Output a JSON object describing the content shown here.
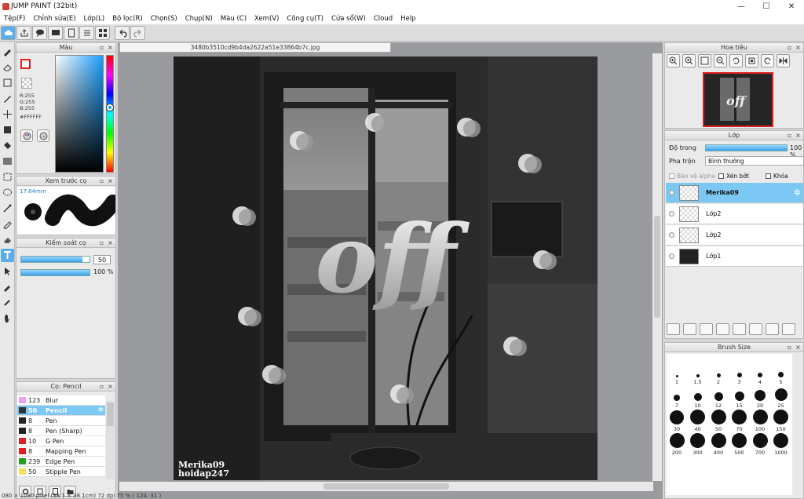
{
  "window": {
    "title": "JUMP PAINT (32bit)",
    "minimize": "—",
    "maximize": "☐",
    "close": "✕"
  },
  "menu": [
    "Tệp(F)",
    "Chỉnh sửa(E)",
    "Lớp(L)",
    "Bộ lọc(R)",
    "Chọn(S)",
    "Chụp(N)",
    "Màu (C)",
    "Xem(V)",
    "Công cụ(T)",
    "Cửa sổ(W)",
    "Cloud",
    "Help"
  ],
  "canvas": {
    "filename": "3480b3510cd9b4da2622a51e33864b7c.jpg",
    "artwork_text": "off",
    "watermark_line1": "Merika09",
    "watermark_line2": "hoidap247"
  },
  "color_panel": {
    "title": "Màu",
    "r": "R:255",
    "g": "G:255",
    "b": "B:255",
    "hex": "#FFFFFF"
  },
  "brush_preview": {
    "title": "Xem trước cọ",
    "size": "17.64mm"
  },
  "brush_control": {
    "title": "Kiểm soát cọ",
    "size_value": "50",
    "size_fraction": 0.9,
    "opacity_value": "100 %",
    "opacity_fraction": 1.0
  },
  "brush_list": {
    "title": "Cọ: Pencil",
    "items": [
      {
        "size": "123",
        "name": "Blur",
        "color": "#f0a0f0",
        "selected": false
      },
      {
        "size": "50",
        "name": "Pencil",
        "color": "#333333",
        "selected": true
      },
      {
        "size": "8",
        "name": "Pen",
        "color": "#222222",
        "selected": false
      },
      {
        "size": "8",
        "name": "Pen (Sharp)",
        "color": "#222222",
        "selected": false
      },
      {
        "size": "10",
        "name": "G Pen",
        "color": "#e02020",
        "selected": false
      },
      {
        "size": "8",
        "name": "Mapping Pen",
        "color": "#e02020",
        "selected": false
      },
      {
        "size": "239",
        "name": "Edge Pen",
        "color": "#20a020",
        "selected": false
      },
      {
        "size": "50",
        "name": "Stipple Pen",
        "color": "#f0e060",
        "selected": false
      }
    ]
  },
  "navigator": {
    "title": "Hoa tiêu"
  },
  "layer_panel": {
    "title": "Lớp",
    "opacity_label": "Độ trong",
    "opacity_value": "100 %",
    "blend_label": "Pha trộn",
    "blend_value": "Bình thường",
    "protect_alpha": "Bảo vệ alpha",
    "clipping": "Xén bớt",
    "lock": "Khóa",
    "layers": [
      {
        "name": "Merika09",
        "selected": true
      },
      {
        "name": "Lớp2",
        "selected": false
      },
      {
        "name": "Lớp2",
        "selected": false
      },
      {
        "name": "Lớp1",
        "selected": false
      }
    ]
  },
  "brush_size": {
    "title": "Brush Size",
    "sizes": [
      "1",
      "1.5",
      "2",
      "3",
      "4",
      "5",
      "7",
      "10",
      "12",
      "15",
      "20",
      "25",
      "30",
      "40",
      "50",
      "70",
      "100",
      "150",
      "200",
      "300",
      "400",
      "500",
      "700",
      "1000"
    ]
  },
  "status": "080 × 1080 pixel   (38.1 × 38.1cm)   72 dpi   75 %   ( 124, 31 )"
}
